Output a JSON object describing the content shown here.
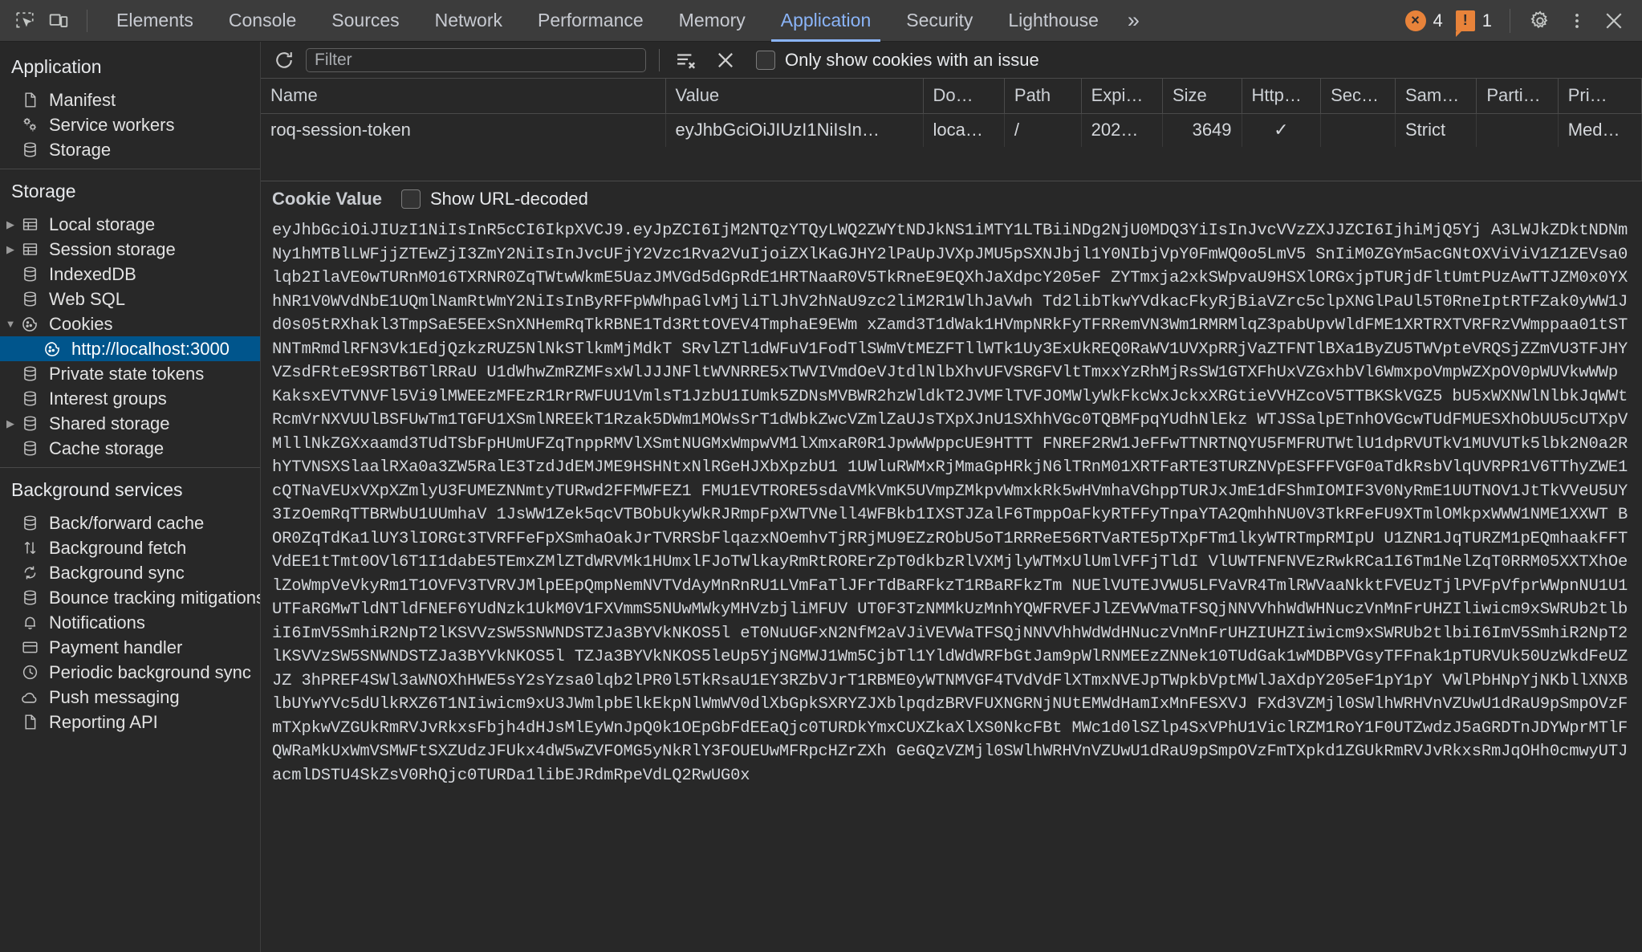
{
  "toolbar": {
    "inspect_icon": "inspect-element-icon",
    "device_icon": "device-toolbar-icon",
    "tabs": [
      {
        "label": "Elements",
        "active": false
      },
      {
        "label": "Console",
        "active": false
      },
      {
        "label": "Sources",
        "active": false
      },
      {
        "label": "Network",
        "active": false
      },
      {
        "label": "Performance",
        "active": false
      },
      {
        "label": "Memory",
        "active": false
      },
      {
        "label": "Application",
        "active": true
      },
      {
        "label": "Security",
        "active": false
      },
      {
        "label": "Lighthouse",
        "active": false
      }
    ],
    "more_tabs": "»",
    "error_count": "4",
    "warning_count": "1",
    "error_glyph": "×",
    "warning_glyph": "!",
    "settings_icon": "gear-icon",
    "more_icon": "kebab-menu-icon",
    "close_icon": "close-icon"
  },
  "sidebar": {
    "sections": [
      {
        "title": "Application",
        "items": [
          {
            "label": "Manifest",
            "icon": "document-icon",
            "indent": 1,
            "twisty": "",
            "selected": false
          },
          {
            "label": "Service workers",
            "icon": "gears-icon",
            "indent": 1,
            "twisty": "",
            "selected": false
          },
          {
            "label": "Storage",
            "icon": "database-icon",
            "indent": 1,
            "twisty": "",
            "selected": false
          }
        ]
      },
      {
        "title": "Storage",
        "items": [
          {
            "label": "Local storage",
            "icon": "table-icon",
            "indent": 1,
            "twisty": "▶",
            "selected": false
          },
          {
            "label": "Session storage",
            "icon": "table-icon",
            "indent": 1,
            "twisty": "▶",
            "selected": false
          },
          {
            "label": "IndexedDB",
            "icon": "database-icon",
            "indent": 1,
            "twisty": "",
            "selected": false
          },
          {
            "label": "Web SQL",
            "icon": "database-icon",
            "indent": 1,
            "twisty": "",
            "selected": false
          },
          {
            "label": "Cookies",
            "icon": "cookie-icon",
            "indent": 1,
            "twisty": "▼",
            "selected": false
          },
          {
            "label": "http://localhost:3000",
            "icon": "cookie-icon",
            "indent": 2,
            "twisty": "",
            "selected": true
          },
          {
            "label": "Private state tokens",
            "icon": "database-icon",
            "indent": 1,
            "twisty": "",
            "selected": false
          },
          {
            "label": "Interest groups",
            "icon": "database-icon",
            "indent": 1,
            "twisty": "",
            "selected": false
          },
          {
            "label": "Shared storage",
            "icon": "database-icon",
            "indent": 1,
            "twisty": "▶",
            "selected": false
          },
          {
            "label": "Cache storage",
            "icon": "database-icon",
            "indent": 1,
            "twisty": "",
            "selected": false
          }
        ]
      },
      {
        "title": "Background services",
        "items": [
          {
            "label": "Back/forward cache",
            "icon": "database-icon",
            "indent": 1,
            "twisty": "",
            "selected": false
          },
          {
            "label": "Background fetch",
            "icon": "arrows-updown-icon",
            "indent": 1,
            "twisty": "",
            "selected": false
          },
          {
            "label": "Background sync",
            "icon": "sync-icon",
            "indent": 1,
            "twisty": "",
            "selected": false
          },
          {
            "label": "Bounce tracking mitigations",
            "icon": "database-icon",
            "indent": 1,
            "twisty": "",
            "selected": false
          },
          {
            "label": "Notifications",
            "icon": "bell-icon",
            "indent": 1,
            "twisty": "",
            "selected": false
          },
          {
            "label": "Payment handler",
            "icon": "credit-card-icon",
            "indent": 1,
            "twisty": "",
            "selected": false
          },
          {
            "label": "Periodic background sync",
            "icon": "clock-icon",
            "indent": 1,
            "twisty": "",
            "selected": false
          },
          {
            "label": "Push messaging",
            "icon": "cloud-icon",
            "indent": 1,
            "twisty": "",
            "selected": false
          },
          {
            "label": "Reporting API",
            "icon": "document-icon",
            "indent": 1,
            "twisty": "",
            "selected": false
          }
        ]
      }
    ]
  },
  "filterbar": {
    "reload_icon": "refresh-icon",
    "filter_placeholder": "Filter",
    "filter_value": "",
    "clear_filtered_icon": "clear-filtered-cookies-icon",
    "clear_all_icon": "clear-all-cookies-icon",
    "issue_checkbox_label": "Only show cookies with an issue",
    "issue_checkbox_checked": false
  },
  "cookie_table": {
    "columns": [
      "Name",
      "Value",
      "Do…",
      "Path",
      "Expi…",
      "Size",
      "Http…",
      "Sec…",
      "Sam…",
      "Parti…",
      "Pri…"
    ],
    "rows": [
      {
        "name": "roq-session-token",
        "value": "eyJhbGciOiJIUzI1NiIsIn…",
        "domain": "loca…",
        "path": "/",
        "expires": "202…",
        "size": "3649",
        "http_only": "✓",
        "secure": "",
        "samesite": "Strict",
        "partition_key": "",
        "priority": "Med…"
      }
    ]
  },
  "cookie_value_panel": {
    "title": "Cookie Value",
    "show_url_decoded_label": "Show URL-decoded",
    "show_url_decoded_checked": false,
    "value": "eyJhbGciOiJIUzI1NiIsInR5cCI6IkpXVCJ9.eyJpZCI6IjM2NTQzYTQyLWQ2ZWYtNDJkNS1iMTY1LTBiiNDg2NjU0MDQ3YiIsInJvcVVzZXJJZCI6IjhiMjQ5Yj A3LWJkZDktNDNmNy1hMTBlLWFjjZTEwZjI3ZmY2NiIsInJvcUFjY2Vzc1Rva2VuIjoiZXlKaGJHY2lPaUpJVXpJMU5pSXNJbjl1Y0NIbjVpY0FmWQ0o5LmV5 SnIiM0ZGYm5acGNtOXViViV1Z1ZEVsa0lqb2IlaVE0wTURnM016TXRNR0ZqTWtwWkmE5UazJMVGd5dGpRdE1HRTNaaR0V5TkRneE9EQXhJaXdpcY205eF ZYTmxja2xkSWpvaU9HSXlORGxjpTURjdFltUmtPUzAwTTJZM0x0YXhNR1V0WVdNbE1UQmlNamRtWmY2NiIsInByRFFpWWhpaGlvMjliTlJhV2hNaU9zc2liM2R1WlhJaVwh Td2libTkwYVdkacFkyRjBiaVZrc5clpXNGlPaUl5T0RneIptRTFZak0yWW1Jd0s05tRXhakl3TmpSaE5EExSnXNHemRqTkRBNE1Td3RttOVEV4TmphaE9EWm xZamd3T1dWak1HVmpNRkFyTFRRemVN3Wm1RMRMlqZ3pabUpvWldFME1XRTRXTVRFRzVWmppaa01tSTNNTmRmdlRFN3Vk1EdjQzkzRUZ5NlNkSTlkmMjMdkT SRvlZTl1dWFuV1FodTlSWmVtMEZFTllWTk1Uy3ExUkREQ0RaWV1UVXpRRjVaZTFNTlBXa1ByZU5TWVpteVRQSjZZmVU3TFJHYVZsdFRteE9SRTB6TlRRaU U1dWhwZmRZMFsxWlJJJNFltWVNRRE5xTWVIVmdOeVJtdlNlbXhvUFVSRGFVltTmxxYzRhMjRsSW1GTXFhUxVZGxhbVl6WmxpoVmpWZXpOV0pWUVkwWWp KaksxEVTVNVFl5Vi9lMWEEzMFEzR1RrRWFUU1VmlsT1JzbU1IUmk5ZDNsMVBWR2hzWldkT2JVMFlTVFJOMWlyWkFkcWxJckxXRGtieVVHZcoV5TTBKSkVGZ5 bU5xWXNWlNlbkJqWWtRcmVrNXVUUlBSFUwTm1TGFU1XSmlNREEkT1Rzak5DWm1MOWsSrT1dWbkZwcVZmlZaUJsTXpXJnU1SXhhVGc0TQBMFpqYUdhNlEkz WTJSSalpETnhOVGcwTUdFMUESXhObUU5cUTXpVMlllNkZGXxaamd3TUdTSbFpHUmUFZqTnppRMVlXSmtNUGMxWmpwVM1lXmxaR0R1JpwWWppcUE9HTTT FNREF2RW1JeFFwTTNRTNQYU5FMFRUTWtlU1dpRVUTkV1MUVUTk5lbk2N0a2RhYTVNSXSlaalRXa0a3ZW5RalE3TzdJdEMJME9HSHNtxNlRGeHJXbXpzbU1 1UWluRWMxRjMmaGpHRkjN6lTRnM01XRTFaRTE3TURZNVpESFFFVGF0aTdkRsbVlqUVRPR1V6TThyZWE1cQTNaVEUxVXpXZmlyU3FUMEZNNmtyTURwd2FFMWFEZ1 FMU1EVTRORE5sdaVMkVmK5UVmpZMkpvWmxkRk5wHVmhaVGhppTURJxJmE1dFShmIOMIF3V0NyRmE1UUTNOV1JtTkVVeU5UY3IzOemRqTTBRWbU1UUmhaV 1JsWW1Zek5qcVTBObUkyWkRJRmpFpXWTVNell4WFBkb1IXSTJZalF6TmppOaFkyRTFFyTnpaYTA2QmhhNU0V3TkRFeFU9XTmlOMkpxWWW1NME1XXWT BOR0ZqTdKa1lUY3lIORGt3TVRFFeFpXSmhaOakJrTVRRSbFlqazxNOemhvTjRRjMU9EZzRObU5oT1RRReE56RTVaRTE5pTXpFTm1lkyWTRTmpRMIpU U1ZNR1JqTURZM1pEQmhaakFFTVdEE1tTmt0OVl6T1I1dabE5TEmxZMlZTdWRVMk1HUmxlFJoTWlkayRmRtRORErZpT0dkbzRlVXMjlyWTMxUlUmlVFFjTldI VlUWTFNFNVEzRwkRCa1I6Tm1NelZqT0RRM05XXTXhOelZoWmpVeVkyRm1T1OVFV3TVRVJMlpEEpQmpNemNVTVdAyMnRnRU1LVmFaTlJFrTdBaRFkzT1RBaRFkzTm NUElVUTEJVWU5LFVaVR4TmlRWVaaNkktFVEUzTjlPVFpVfprWWpnNU1U1UTFaRGMwTldNTldFNEF6YUdNzk1UkM0V1FXVmmS5NUwMWkyMHVzbjliMFUV UT0F3TzNMMkUzMnhYQWFRVEFJlZEVWVmaTFSQjNNVVhhWdWHNuczVnMnFrUHZIliwicm9xSWRUb2tlbiI6ImV5SmhiR2NpT2lKSVVzSW5SNWNDSTZJa3BYVkNKOS5l eT0NuUGFxN2NfM2aVJiVEVWaTFSQjNNVVhhWdWdHNuczVnMnFrUHZIUHZIiwicm9xSWRUb2tlbiI6ImV5SmhiR2NpT2lKSVVzSW5SNWNDSTZJa3BYVkNKOS5l TZJa3BYVkNKOS5leUp5YjNGMWJ1Wm5CjbTl1YldWdWRFbGtJam9pWlRNMEEzZNNek10TUdGak1wMDBPVGsyTFFnak1pTURVUk50UzWkdFeUZJZ 3hPREF4SWl3aWNOXhHWE5sY2sYzsa0lqb2lPR0l5TkRsaU1EY3RZbVJrT1RBME0yWTNMVGF4TVdVdFlXTmxNVEJpTWpkbVptMWlJaXdpY205eF1pY1pY VWlPbHNpYjNKbllXNXBlbUYwYVc5dUlkRXZ6T1NIiwicm9xU3JWmlpbElkEkpNlWmWV0dlXbGpkSXRYZJXblpqdzBRVFUXNGRNjNUtEMWdHamIxMnFESXVJ FXd3VZMjl0SWlhWRHVnVZUwU1dRaU9pSmpOVzFmTXpkwVZGUkRmRVJvRkxsFbjh4dHJsMlEyWnJpQ0k1OEpGbFdEEaQjc0TURDkYmxCUXZkaXlXS0NkcFBt MWc1d0lSZlp4SxVPhU1ViclRZM1RoY1F0UTZwdzJ5aGRDTnJDYWprMTlFQWRaMkUxWmVSMWFtSXZUdzJFUkx4dW5wZVFOMG5yNkRlY3FOUEUwMFRpcHZrZXh GeGQzVZMjl0SWlhWRHVnVZUwU1dRaU9pSmpOVzFmTXpkd1ZGUkRmRVJvRkxsRmJqOHh0cmwyUTJacmlDSTU4SkZsV0RhQjc0TURDa1libEJRdmRpeVdLQ2RwUG0x",
    "value_lines_truncated": true
  }
}
